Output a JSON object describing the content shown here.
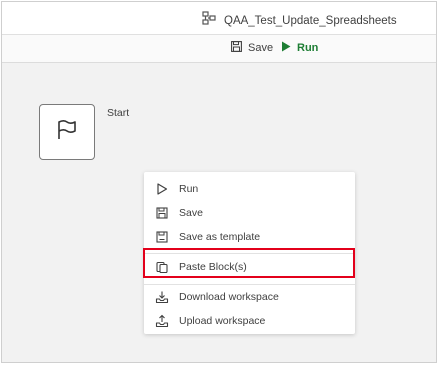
{
  "titlebar": {
    "title": "QAA_Test_Update_Spreadsheets",
    "icon": "workflow-icon"
  },
  "toolbar": {
    "save_label": "Save",
    "run_label": "Run",
    "run_color": "#1e7e34"
  },
  "canvas": {
    "start_block": {
      "label": "Start",
      "icon": "flag-icon"
    }
  },
  "context_menu": {
    "items": [
      {
        "label": "Run",
        "icon": "play-outline-icon"
      },
      {
        "label": "Save",
        "icon": "save-icon"
      },
      {
        "label": "Save as template",
        "icon": "save-template-icon"
      },
      {
        "label": "Paste Block(s)",
        "icon": "paste-icon",
        "highlighted": true
      },
      {
        "label": "Download workspace",
        "icon": "download-icon"
      },
      {
        "label": "Upload workspace",
        "icon": "upload-icon"
      }
    ],
    "highlight_color": "#e3001b"
  }
}
